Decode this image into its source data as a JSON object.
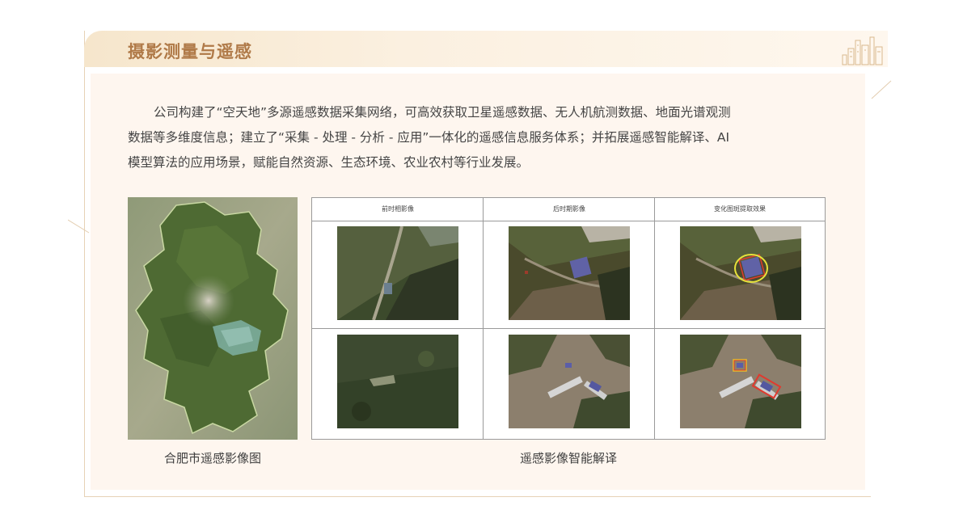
{
  "section": {
    "title": "摄影测量与遥感"
  },
  "intro": {
    "lines": [
      "公司构建了“空天地”多源遥感数据采集网络，可高效获取卫星遥感数据、无人机航测数据、地面光谱观测",
      "数据等多维度信息；建立了“采集 - 处理 - 分析 - 应用”一体化的遥感信息服务体系；并拓展遥感智能解译、AI",
      "模型算法的应用场景，赋能自然资源、生态环境、农业农村等行业发展。"
    ]
  },
  "map_figure": {
    "caption": "合肥市遥感影像图"
  },
  "interpretation_figure": {
    "columns": [
      "前时相影像",
      "后时期影像",
      "变化图斑提取效果"
    ],
    "caption": "遥感影像智能解译"
  },
  "colors": {
    "title": "#b07a48",
    "header_bg": "#f6e6cc",
    "content_bg": "#fef6ef",
    "border": "#e6d2b6"
  },
  "icons": [
    "building-skyline-icon"
  ]
}
